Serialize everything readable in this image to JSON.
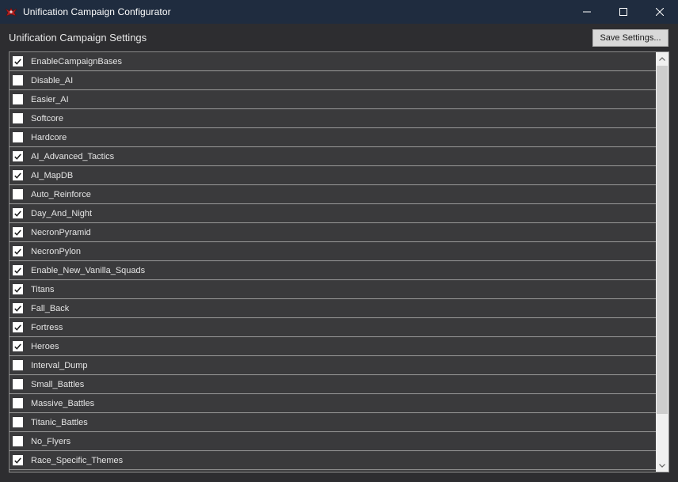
{
  "window": {
    "title": "Unification Campaign Configurator",
    "icon": "red-winged-emblem-icon"
  },
  "controls": {
    "minimize": "minimize-icon",
    "maximize": "maximize-icon",
    "close": "close-icon"
  },
  "header": {
    "title": "Unification Campaign Settings",
    "save_label": "Save Settings..."
  },
  "settings": [
    {
      "label": "EnableCampaignBases",
      "checked": true
    },
    {
      "label": "Disable_AI",
      "checked": false
    },
    {
      "label": "Easier_AI",
      "checked": false
    },
    {
      "label": "Softcore",
      "checked": false
    },
    {
      "label": "Hardcore",
      "checked": false
    },
    {
      "label": "AI_Advanced_Tactics",
      "checked": true
    },
    {
      "label": "AI_MapDB",
      "checked": true
    },
    {
      "label": "Auto_Reinforce",
      "checked": false
    },
    {
      "label": "Day_And_Night",
      "checked": true
    },
    {
      "label": "NecronPyramid",
      "checked": true
    },
    {
      "label": "NecronPylon",
      "checked": true
    },
    {
      "label": "Enable_New_Vanilla_Squads",
      "checked": true
    },
    {
      "label": "Titans",
      "checked": true
    },
    {
      "label": "Fall_Back",
      "checked": true
    },
    {
      "label": "Fortress",
      "checked": true
    },
    {
      "label": "Heroes",
      "checked": true
    },
    {
      "label": "Interval_Dump",
      "checked": false
    },
    {
      "label": "Small_Battles",
      "checked": false
    },
    {
      "label": "Massive_Battles",
      "checked": false
    },
    {
      "label": "Titanic_Battles",
      "checked": false
    },
    {
      "label": "No_Flyers",
      "checked": false
    },
    {
      "label": "Race_Specific_Themes",
      "checked": true
    }
  ],
  "colors": {
    "titlebar": "#1f2c3f",
    "background": "#2d2d30",
    "list_background": "#3a3a3c",
    "row_border": "#9a9a9a"
  }
}
